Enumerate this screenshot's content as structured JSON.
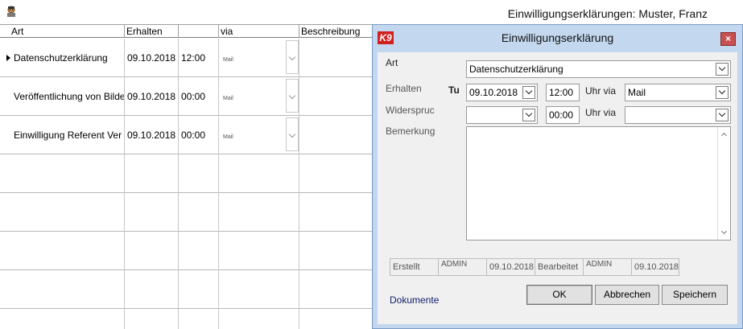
{
  "app": {
    "window_title": "Einwilligungserklärungen: Muster, Franz",
    "icon": "worker-icon"
  },
  "grid": {
    "columns": [
      "Art",
      "Erhalten",
      "",
      "via",
      "Beschreibung"
    ],
    "rows": [
      {
        "art": "Datenschutzerklärung",
        "date": "09.10.2018",
        "time": "12:00",
        "via": "Mail"
      },
      {
        "art": "Veröffentlichung von Bilde",
        "date": "09.10.2018",
        "time": "00:00",
        "via": "Mail"
      },
      {
        "art": "Einwilligung Referent Ver",
        "date": "09.10.2018",
        "time": "00:00",
        "via": "Mail"
      }
    ],
    "selected_row": 0
  },
  "dialog": {
    "logo_text": "K9",
    "title": "Einwilligungserklärung",
    "close_label": "×",
    "art_label": "Art",
    "art_value": "Datenschutzerklärung",
    "erhalten_label": "Erhalten",
    "erhalten_day": "Tu",
    "erhalten_date": "09.10.2018",
    "erhalten_time": "12:00",
    "uhr_via_label": "Uhr via",
    "erhalten_via": "Mail",
    "widerspruch_label": "Widerspruc",
    "widerspruch_date": "",
    "widerspruch_time": "00:00",
    "widerspruch_uhr_via_label": "Uhr via",
    "widerspruch_via": "",
    "bemerkung_label": "Bemerkung",
    "bemerkung_value": "",
    "erstellt_label": "Erstellt",
    "erstellt_user": "ADMIN",
    "erstellt_date": "09.10.2018",
    "bearbeitet_label": "Bearbeitet",
    "bearbeitet_user": "ADMIN",
    "bearbeitet_date": "09.10.2018",
    "dokumente_label": "Dokumente",
    "ok_label": "OK",
    "cancel_label": "Abbrechen",
    "save_label": "Speichern"
  },
  "colors": {
    "dialog_frame": "#c3d7ee",
    "dialog_body": "#f0f0f0",
    "close_button": "#c75050",
    "logo": "#d21f1f"
  }
}
